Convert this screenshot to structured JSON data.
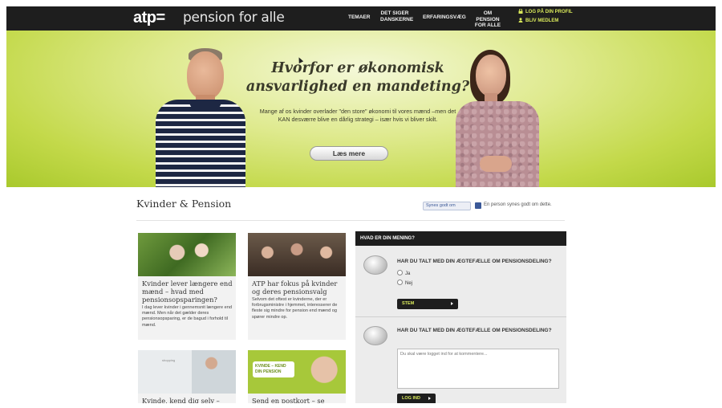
{
  "header": {
    "logo": "atp=",
    "logo_sub": "pension for alle",
    "nav": [
      {
        "label": "TEMAER"
      },
      {
        "label": "DET SIGER DANSKERNE"
      },
      {
        "label": "ERFARINGSVÆG"
      },
      {
        "label": "OM PENSION FOR ALLE"
      }
    ],
    "login_label": "LOG PÅ DIN PROFIL",
    "signup_label": "BLIV MEDLEM"
  },
  "hero": {
    "title": "Hvorfor er økonomisk ansvarlighed en mandeting?",
    "text": "Mange af os kvinder overlader \"den store\" økonomi til vores mænd –men det KAN desværre blive en dårlig strategi – især hvis vi bliver skilt.",
    "button": "Læs mere"
  },
  "section": {
    "title": "Kvinder & Pension",
    "like_button": "Synes godt om",
    "like_text": "En person synes godt om dette."
  },
  "articles": [
    {
      "title": "Kvinder lever længere end mænd – hvad med pensionsopsparingen?",
      "text": "I dag lever kvinder i gennemsnit længere end mænd. Men når det gælder deres pensionsopsparing, er de bagud i forhold til mænd."
    },
    {
      "title": "ATP har fokus på kvinder og deres pensionsvalg",
      "text": "Selvom det oftest er kvinderne, der er forbrugsministre i hjemmet, interesserer de fleste sig mindre for pension end mænd og spører mindre op."
    },
    {
      "title": "Kvinde, kend dig selv – pension",
      "text": ""
    },
    {
      "title": "Send en postkort – se mere",
      "text": ""
    }
  ],
  "banner_text": "KVINDE – KEND DIN PENSION",
  "card3_overlay": "shopping",
  "poll": {
    "header": "HVAD ER DIN MENING?",
    "q1": "HAR DU TALT MED DIN ÆGTEFÆLLE OM PENSIONSDELING?",
    "options": [
      "Ja",
      "Nej"
    ],
    "vote_button": "STEM",
    "q2": "HAR DU TALT MED DIN ÆGTEFÆLLE OM PENSIONSDELING?",
    "textarea_placeholder": "Du skal være logget ind for at kommentere...",
    "login_button": "LOG IND"
  }
}
